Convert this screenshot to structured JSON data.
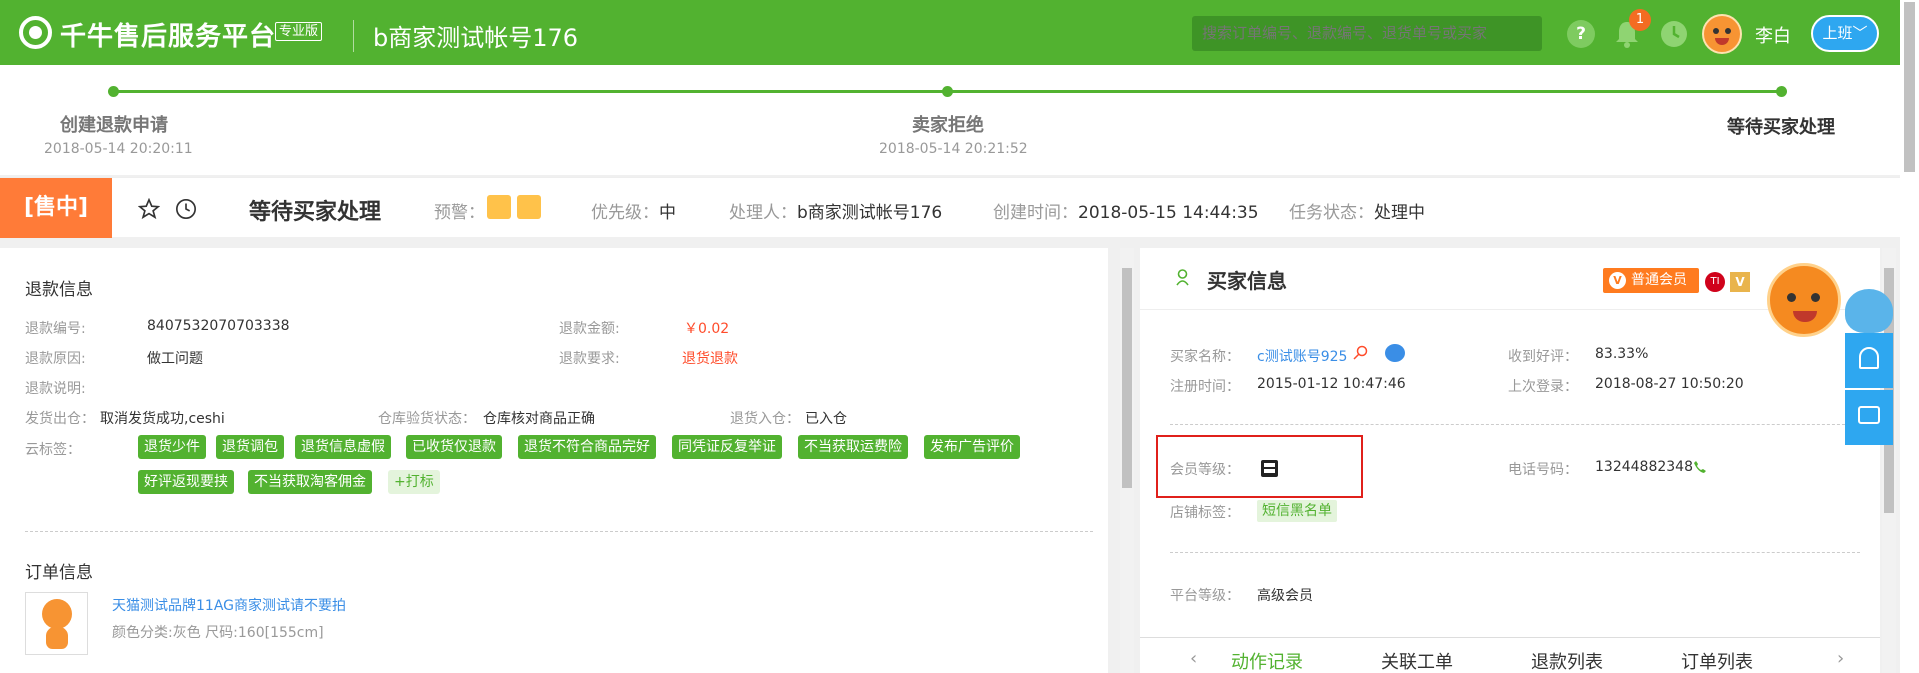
{
  "header": {
    "brand": "千牛售后服务平台",
    "brand_badge": "专业版",
    "account": "b商家测试帐号176",
    "search_placeholder": "搜索订单编号、退款编号、退货单号或买家",
    "help_icon": "?",
    "notif_count": "1",
    "username": "李白",
    "duty_label": "上班﹀"
  },
  "progress": {
    "steps": [
      {
        "label": "创建退款申请",
        "time": "2018-05-14 20:20:11"
      },
      {
        "label": "卖家拒绝",
        "time": "2018-05-14 20:21:52"
      },
      {
        "label": "等待买家处理",
        "time": ""
      }
    ]
  },
  "status": {
    "sale_tag": "[售中]",
    "title": "等待买家处理",
    "warning_label": "预警：",
    "priority_label": "优先级：",
    "priority_value": "中",
    "handler_label": "处理人：",
    "handler_value": "b商家测试帐号176",
    "created_label": "创建时间：",
    "created_value": "2018-05-15 14:44:35",
    "task_label": "任务状态：",
    "task_value": "处理中"
  },
  "refund": {
    "section_title": "退款信息",
    "no_label": "退款编号:",
    "no_value": "8407532070703338",
    "amount_label": "退款金额:",
    "amount_value": "￥0.02",
    "reason_label": "退款原因:",
    "reason_value": "做工问题",
    "request_label": "退款要求:",
    "request_value": "退货退款",
    "desc_label": "退款说明:",
    "ship_label": "发货出仓：",
    "ship_value": "取消发货成功,ceshi",
    "inspect_label": "仓库验货状态：",
    "inspect_value": "仓库核对商品正确",
    "return_label": "退货入仓：",
    "return_value": "已入仓",
    "cloud_label": "云标签：",
    "tags_row1": [
      "退货少件",
      "退货调包",
      "退货信息虚假",
      "已收货仅退款",
      "退货不符合商品完好",
      "同凭证反复举证",
      "不当获取运费险",
      "发布广告评价"
    ],
    "tags_row2": [
      "好评返现要挟",
      "不当获取淘客佣金"
    ],
    "add_tag": "+打标"
  },
  "order": {
    "section_title": "订单信息",
    "product_name": "天猫测试品牌11AG商家测试请不要拍",
    "product_spec": "颜色分类:灰色 尺码:160[155cm]"
  },
  "buyer": {
    "title": "买家信息",
    "vip_label": "普通会员",
    "ti_badge": "TI",
    "v_badge": "V",
    "name_label": "买家名称：",
    "name_value": "c测试账号925",
    "good_rate_label": "收到好评：",
    "good_rate_value": "83.33%",
    "reg_label": "注册时间：",
    "reg_value": "2015-01-12 10:47:46",
    "last_login_label": "上次登录：",
    "last_login_value": "2018-08-27 10:50:20",
    "level_label": "会员等级：",
    "phone_label": "电话号码：",
    "phone_value": "13244882348",
    "shop_tag_label": "店铺标签：",
    "shop_tag_value": "短信黑名单",
    "platform_label": "平台等级：",
    "platform_value": "高级会员"
  },
  "tabs": [
    "动作记录",
    "关联工单",
    "退款列表",
    "订单列表"
  ],
  "colors": {
    "brand_green": "#52b230",
    "accent_orange": "#ff7b38",
    "link_blue": "#3a8ee6",
    "warn_red": "#ff4c2b",
    "highlight_red": "#e0201b"
  }
}
